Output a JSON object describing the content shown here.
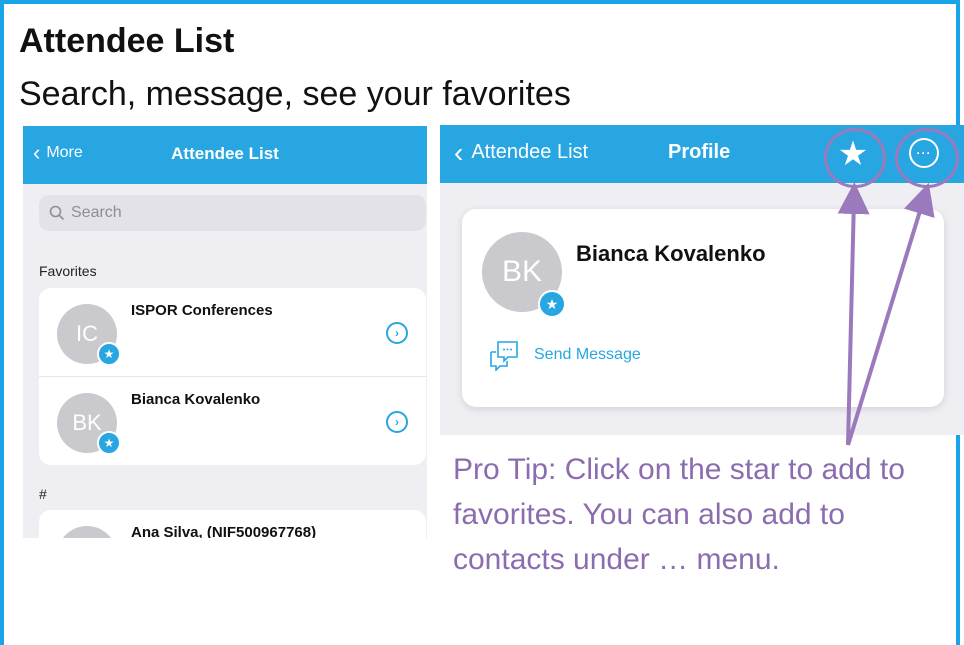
{
  "slide": {
    "title": "Attendee List",
    "subtitle": "Search, message, see your favorites",
    "pro_tip": "Pro Tip: Click on the star to add to favorites. You can also add to contacts under … menu."
  },
  "left_screen": {
    "back_label": "More",
    "title": "Attendee List",
    "search_placeholder": "Search",
    "favorites_label": "Favorites",
    "favorites": [
      {
        "initials": "IC",
        "name": "ISPOR Conferences"
      },
      {
        "initials": "BK",
        "name": "Bianca Kovalenko"
      }
    ],
    "section_hash": "#",
    "others": [
      {
        "initials": "",
        "name": "Ana Silva, (NIF500967768)"
      }
    ]
  },
  "right_screen": {
    "back_label": "Attendee List",
    "title": "Profile",
    "profile": {
      "initials": "BK",
      "name": "Bianca Kovalenko"
    },
    "send_message_label": "Send Message"
  },
  "colors": {
    "accent": "#27a6e2",
    "annotation": "#9b79bd",
    "frame": "#1aa3e8"
  },
  "icons": [
    "chevron-left-icon",
    "search-icon",
    "star-icon",
    "more-icon",
    "chat-icon",
    "chevron-right-circle-icon"
  ]
}
